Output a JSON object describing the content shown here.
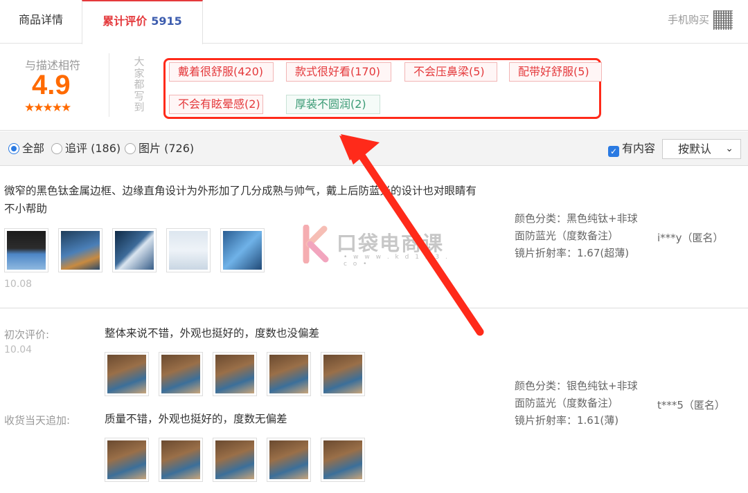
{
  "tabs": {
    "details": "商品详情",
    "reviews_label": "累计评价",
    "reviews_count": "5915",
    "mobile_buy": "手机购买"
  },
  "rating": {
    "label": "与描述相符",
    "score": "4.9",
    "stars": "★★★★★",
    "caption": "大家都写到"
  },
  "tags": [
    {
      "text": "戴着很舒服(420)",
      "sentiment": "positive"
    },
    {
      "text": "款式很好看(170)",
      "sentiment": "positive"
    },
    {
      "text": "不会压鼻梁(5)",
      "sentiment": "positive"
    },
    {
      "text": "配带好舒服(5)",
      "sentiment": "positive"
    },
    {
      "text": "不会有眩晕感(2)",
      "sentiment": "positive"
    },
    {
      "text": "厚装不圆润(2)",
      "sentiment": "negative"
    }
  ],
  "filter": {
    "all": "全部",
    "follow_up": "追评 (186)",
    "pictures": "图片 (726)",
    "has_content": "有内容",
    "sort": "按默认"
  },
  "reviews": [
    {
      "text": "微窄的黑色钛金属边框、边缘直角设计为外形加了几分成熟与帅气，戴上后防蓝光的设计也对眼睛有不小帮助",
      "date": "10.08",
      "meta": [
        "颜色分类：黑色纯钛+非球面防蓝光（度数备注）",
        "镜片折射率：1.67(超薄)"
      ],
      "user": "i***y（匿名）"
    },
    {
      "first_label": "初次评价:",
      "first_text": "整体来说不错，外观也挺好的，度数也没偏差",
      "first_date": "10.04",
      "append_label": "收货当天追加:",
      "append_text": "质量不错，外观也挺好的，度数无偏差",
      "meta": [
        "颜色分类：银色纯钛+非球面防蓝光（度数备注）",
        "镜片折射率：1.61(薄)"
      ],
      "user": "t***5（匿名）"
    }
  ],
  "watermark": {
    "text": "口袋电商课",
    "url": "• w w w . k d 1 2 3 . c o •"
  },
  "colors": {
    "accent_red": "#e4393c",
    "score_orange": "#ff6a00",
    "highlight_box": "#ff2a1a",
    "count_blue": "#3c5cae"
  }
}
